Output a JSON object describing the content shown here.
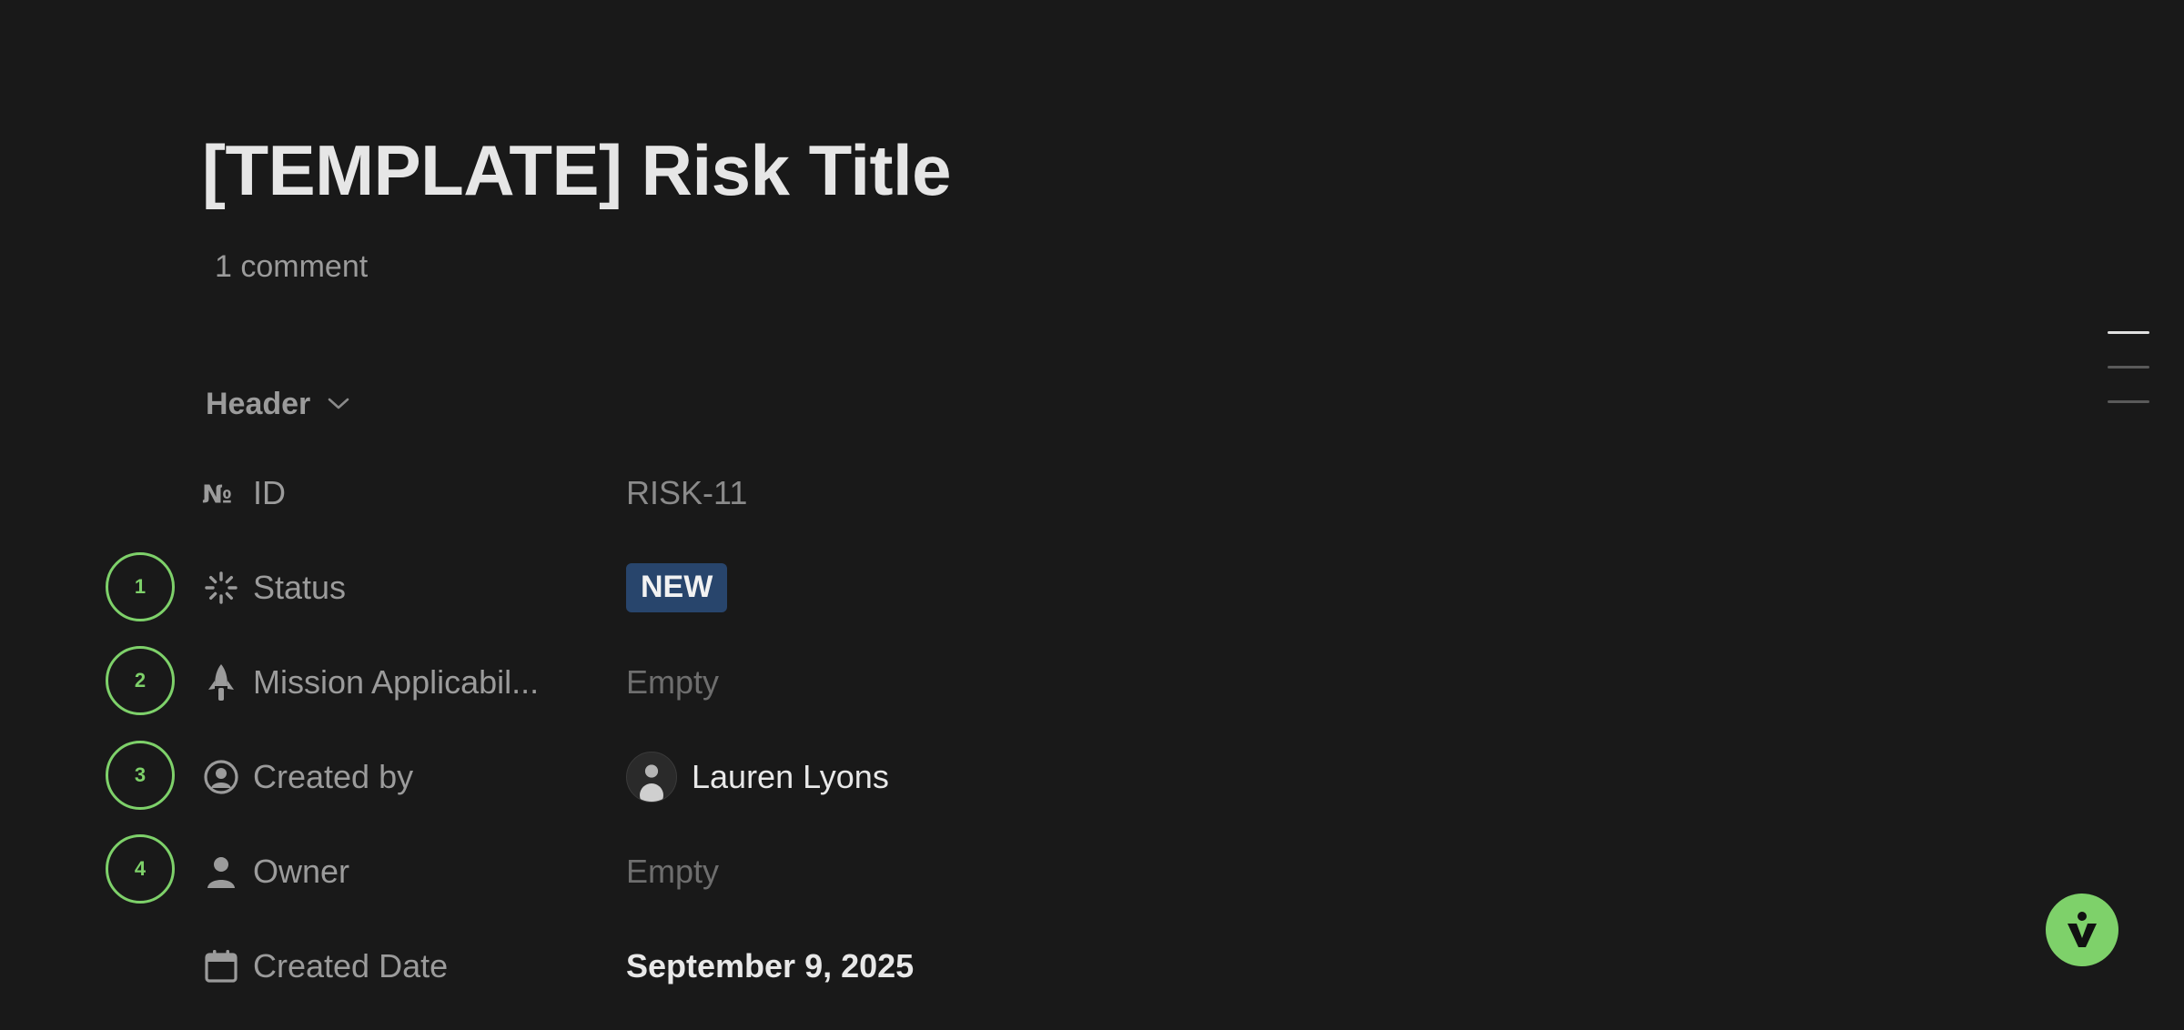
{
  "page": {
    "title": "[TEMPLATE] Risk Title",
    "comment_count": "1 comment"
  },
  "section": {
    "label": "Header"
  },
  "properties": {
    "id": {
      "label": "ID",
      "icon": "number-icon",
      "value": "RISK-11"
    },
    "status": {
      "label": "Status",
      "icon": "status-spinner-icon",
      "value": "NEW",
      "color": "#28456c"
    },
    "mission": {
      "label": "Mission Applicabil...",
      "icon": "rocket-icon",
      "value": "Empty"
    },
    "created_by": {
      "label": "Created by",
      "icon": "user-circle-icon",
      "value": "Lauren Lyons"
    },
    "owner": {
      "label": "Owner",
      "icon": "person-icon",
      "value": "Empty"
    },
    "created_date": {
      "label": "Created Date",
      "icon": "calendar-icon",
      "value": "September 9, 2025"
    }
  },
  "markers": [
    "1",
    "2",
    "3",
    "4"
  ],
  "accent_color": "#7ed16a",
  "fab": {
    "icon": "v-logo-icon"
  }
}
